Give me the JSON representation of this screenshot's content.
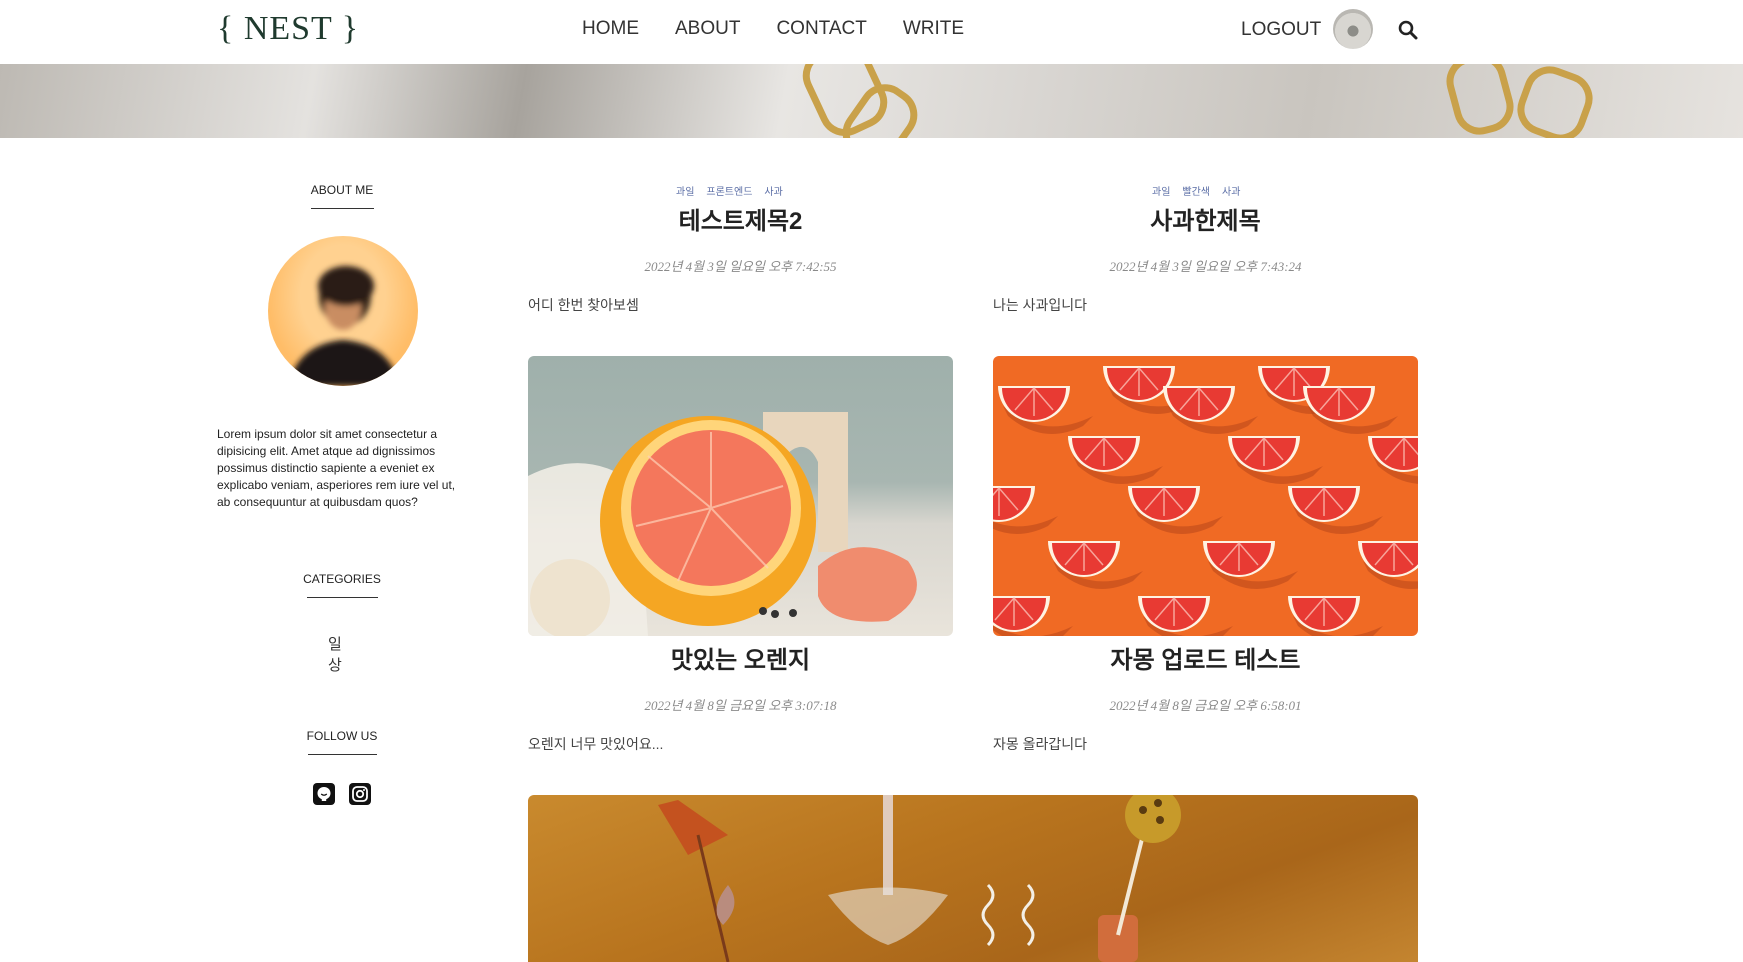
{
  "nav": {
    "logo": "{ NEST }",
    "links": [
      "HOME",
      "ABOUT",
      "CONTACT",
      "WRITE"
    ],
    "logout": "LOGOUT"
  },
  "sidebar": {
    "about_heading": "ABOUT ME",
    "about_text": "Lorem ipsum dolor sit amet consectetur a dipisicing elit. Amet atque ad dignissimos possimus distinctio sapiente a eveniet ex explicabo veniam, asperiores rem iure vel ut, ab consequuntur at quibusdam quos?",
    "categories_heading": "CATEGORIES",
    "category_item": "일상",
    "follow_heading": "FOLLOW US",
    "social": [
      "github-icon",
      "instagram-icon"
    ]
  },
  "posts": [
    {
      "tags": [
        "과일",
        "프론트엔드",
        "사과"
      ],
      "title": "테스트제목2",
      "date": "2022년 4월 3일 일요일 오후 7:42:55",
      "excerpt": "어디 한번 찾아보셈"
    },
    {
      "tags": [
        "과일",
        "빨간색",
        "사과"
      ],
      "title": "사과한제목",
      "date": "2022년 4월 3일 일요일 오후 7:43:24",
      "excerpt": "나는 사과입니다"
    },
    {
      "tags": [],
      "title": "맛있는 오렌지",
      "date": "2022년 4월 8일 금요일 오후 3:07:18",
      "excerpt": "오렌지 너무 맛있어요..."
    },
    {
      "tags": [],
      "title": "자몽 업로드 테스트",
      "date": "2022년 4월 8일 금요일 오후 6:58:01",
      "excerpt": "자몽 올라갑니다"
    }
  ],
  "colors": {
    "accent_green": "#1f3a2e",
    "tag_blue": "#5b6ea6"
  }
}
